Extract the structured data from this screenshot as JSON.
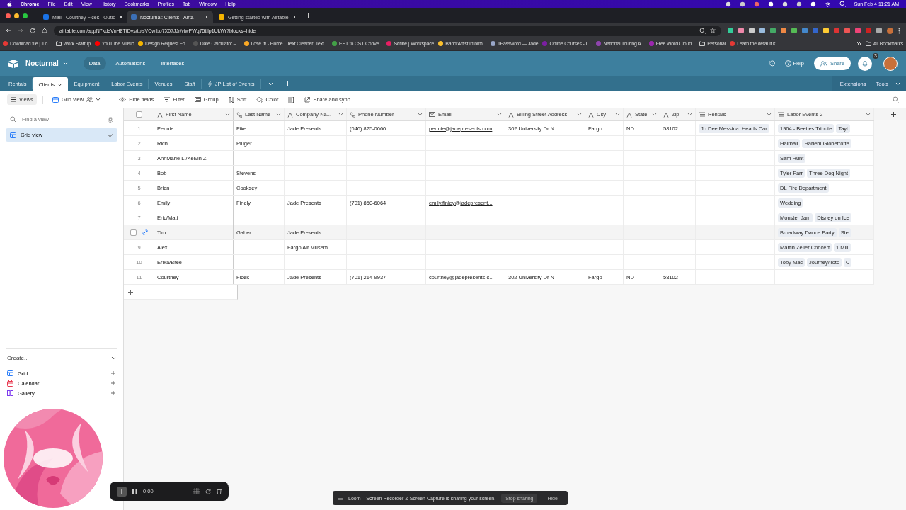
{
  "menu_bar": {
    "items": [
      "Chrome",
      "File",
      "Edit",
      "View",
      "History",
      "Bookmarks",
      "Profiles",
      "Tab",
      "Window",
      "Help"
    ],
    "clock": "Sun Feb 4  11:21 AM"
  },
  "browser_tabs": [
    {
      "title": "Mail - Courtney Ficek - Outlo",
      "selected": false,
      "color": "#1a73e8"
    },
    {
      "title": "Nocturnal: Clients - Airta",
      "selected": true,
      "color": "#3b6fb6"
    },
    {
      "title": "Getting started with Airtable",
      "selected": false,
      "color": "#f4b400"
    }
  ],
  "address": "airtable.com/appN7kdeVnH8TtDvs/tblsVCwlbo7X07JJr/viwPWq75tIlp1UkWr?blocks=hide",
  "bookmarks": [
    {
      "label": "Download file | iLo...",
      "kind": "site",
      "color": "#e53935"
    },
    {
      "label": "Work Startup",
      "kind": "folder"
    },
    {
      "label": "YouTube Music",
      "kind": "site",
      "color": "#ff0000"
    },
    {
      "label": "Design Request Fo...",
      "kind": "site",
      "color": "#f4b400"
    },
    {
      "label": "Date Calculator –...",
      "kind": "site",
      "color": "#555555"
    },
    {
      "label": "Lose It! - Home",
      "kind": "site",
      "color": "#f9a825"
    },
    {
      "label": "Text Cleaner: Text...",
      "kind": "plain"
    },
    {
      "label": "EST to CST Conve...",
      "kind": "site",
      "color": "#43a047"
    },
    {
      "label": "Scribe | Workspace",
      "kind": "site",
      "color": "#e91e63"
    },
    {
      "label": "Band/Artist Inform...",
      "kind": "site",
      "color": "#fbc02d"
    },
    {
      "label": "1Password — Jade",
      "kind": "site",
      "color": "#9aa7c9"
    },
    {
      "label": "Online Courses - L...",
      "kind": "site",
      "color": "#7b1fa2"
    },
    {
      "label": "National Touring A...",
      "kind": "site",
      "color": "#8e44ad"
    },
    {
      "label": "Free Word Cloud...",
      "kind": "site",
      "color": "#9c27b0"
    },
    {
      "label": "Personal",
      "kind": "folder"
    },
    {
      "label": "Learn the default k...",
      "kind": "site",
      "color": "#e53935"
    }
  ],
  "all_bookmarks": "All Bookmarks",
  "base": {
    "name": "Nocturnal",
    "nav": [
      {
        "label": "Data",
        "selected": true
      },
      {
        "label": "Automations",
        "selected": false
      },
      {
        "label": "Interfaces",
        "selected": false
      }
    ],
    "help": "Help",
    "share": "Share",
    "notification_count": "3"
  },
  "tables": [
    {
      "label": "Rentals",
      "selected": false,
      "kind": "table"
    },
    {
      "label": "Clients",
      "selected": true,
      "kind": "table"
    },
    {
      "label": "Equipment",
      "selected": false,
      "kind": "table"
    },
    {
      "label": "Labor Events",
      "selected": false,
      "kind": "table"
    },
    {
      "label": "Venues",
      "selected": false,
      "kind": "table"
    },
    {
      "label": "Staff",
      "selected": false,
      "kind": "table"
    },
    {
      "label": "JP List of Events",
      "selected": false,
      "kind": "synced"
    }
  ],
  "extensions": "Extensions",
  "tools": "Tools",
  "toolbar": {
    "views": "Views",
    "view": "Grid view",
    "actions": [
      {
        "label": "Hide fields",
        "kind": "hide"
      },
      {
        "label": "Filter",
        "kind": "filter"
      },
      {
        "label": "Group",
        "kind": "group"
      },
      {
        "label": "Sort",
        "kind": "sort"
      },
      {
        "label": "Color",
        "kind": "color"
      },
      {
        "kind": "row-height"
      },
      {
        "label": "Share and sync",
        "kind": "share"
      }
    ]
  },
  "sidebar": {
    "search_placeholder": "Find a view",
    "views": [
      {
        "label": "Grid view",
        "selected": true
      }
    ],
    "create_title": "Create...",
    "create_items": [
      {
        "label": "Grid",
        "kind": "grid"
      },
      {
        "label": "Calendar",
        "kind": "calendar"
      },
      {
        "label": "Gallery",
        "kind": "gallery"
      }
    ]
  },
  "table": {
    "select_all": {
      "checked": false
    },
    "columns": [
      {
        "label": "First Name",
        "kind": "text"
      },
      {
        "label": "Last Name",
        "kind": "phone"
      },
      {
        "label": "Company Na...",
        "kind": "text"
      },
      {
        "label": "Phone Number",
        "kind": "phone"
      },
      {
        "label": "Email",
        "kind": "email"
      },
      {
        "label": "Billing Street Address",
        "kind": "text"
      },
      {
        "label": "City",
        "kind": "text"
      },
      {
        "label": "State",
        "kind": "text"
      },
      {
        "label": "Zip",
        "kind": "text"
      },
      {
        "label": "Rentals",
        "kind": "link"
      },
      {
        "label": "Labor Events 2",
        "kind": "link"
      }
    ],
    "rows": [
      {
        "number": "1",
        "hovered": false,
        "cells": [
          "Pennie",
          "Fike",
          "Jade Presents",
          "(646) 825-0660",
          "pennie@jadepresents.com",
          "302 University Dr N",
          "Fargo",
          "ND",
          "58102",
          [
            "Jo Dee Messina: Heads Car"
          ],
          [
            "1964 - Beetles Tribute",
            "Tayl"
          ]
        ]
      },
      {
        "number": "2",
        "hovered": false,
        "cells": [
          "Rich",
          "Pluger",
          null,
          null,
          null,
          null,
          null,
          null,
          null,
          null,
          [
            "Hairball",
            "Harlem Globetrotte"
          ]
        ]
      },
      {
        "number": "3",
        "hovered": false,
        "cells": [
          "AnnMarie L./Kelvin Z.",
          null,
          null,
          null,
          null,
          null,
          null,
          null,
          null,
          null,
          [
            "Sam Hunt"
          ]
        ]
      },
      {
        "number": "4",
        "hovered": false,
        "cells": [
          "Bob",
          "Stevens",
          null,
          null,
          null,
          null,
          null,
          null,
          null,
          null,
          [
            "Tyler Farr",
            "Three Dog Night"
          ]
        ]
      },
      {
        "number": "5",
        "hovered": false,
        "cells": [
          "Brian",
          "Cooksey",
          null,
          null,
          null,
          null,
          null,
          null,
          null,
          null,
          [
            "DL Fire Department"
          ]
        ]
      },
      {
        "number": "6",
        "hovered": false,
        "cells": [
          "Emily",
          "Finely",
          "Jade Presents",
          "(701) 850-6064",
          "emily.finley@jadepresent...",
          null,
          null,
          null,
          null,
          null,
          [
            "Wedding"
          ]
        ]
      },
      {
        "number": "7",
        "hovered": false,
        "cells": [
          "Eric/Matt",
          null,
          null,
          null,
          null,
          null,
          null,
          null,
          null,
          null,
          [
            "Monster Jam",
            "Disney on Ice"
          ]
        ]
      },
      {
        "hovered": true,
        "checked": false,
        "cells": [
          "Tim",
          "Gaber",
          "Jade Presents",
          null,
          null,
          null,
          null,
          null,
          null,
          null,
          [
            "Broadway Dance Party",
            "Ste"
          ]
        ]
      },
      {
        "number": "9",
        "hovered": false,
        "cells": [
          "Alex",
          null,
          "Fargo Air Musem",
          null,
          null,
          null,
          null,
          null,
          null,
          null,
          [
            "Martin Zeller Concert",
            "1 Mill"
          ]
        ]
      },
      {
        "number": "10",
        "hovered": false,
        "cells": [
          "Erika/Bree",
          null,
          null,
          null,
          null,
          null,
          null,
          null,
          null,
          null,
          [
            "Toby Mac",
            "Journey/Toto",
            "C"
          ]
        ]
      },
      {
        "number": "11",
        "hovered": false,
        "cells": [
          "Courtney",
          "Ficek",
          "Jade Presents",
          "(701) 214-9937",
          "courtney@jadepresents.c...",
          "302 University Dr N",
          "Fargo",
          "ND",
          "58102",
          null,
          null
        ]
      }
    ]
  },
  "recorder": {
    "time": "0:00"
  },
  "loom_bar": {
    "message": "Loom – Screen Recorder & Screen Capture is sharing your screen.",
    "stop": "Stop sharing",
    "hide": "Hide"
  }
}
